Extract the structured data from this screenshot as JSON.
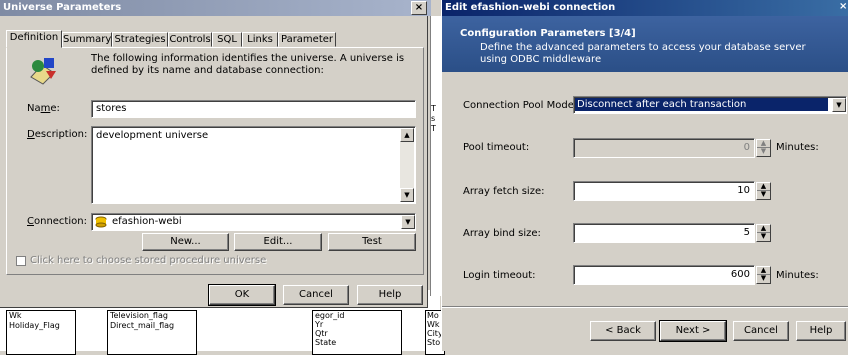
{
  "left": {
    "title": "Universe Parameters",
    "tabs": [
      "Definition",
      "Summary",
      "Strategies",
      "Controls",
      "SQL",
      "Links",
      "Parameter"
    ],
    "intro": "The following information identifies the universe. A universe is defined by its name and database connection:",
    "name_label": "Name:",
    "name_value": "stores",
    "description_label": "Description:",
    "description_value": "development universe",
    "connection_label": "Connection:",
    "connection_value": "efashion-webi",
    "new_button": "New...",
    "edit_button": "Edit...",
    "test_button": "Test",
    "stored_proc_label": "Click here to choose stored procedure universe",
    "ok_button": "OK",
    "cancel_button": "Cancel",
    "help_button": "Help"
  },
  "background": {
    "col1": [
      "Wk",
      "Holiday_Flag"
    ],
    "col2": [
      "Television_flag",
      "Direct_mail_flag"
    ],
    "col3": [
      "Yr",
      "Qtr",
      "State"
    ],
    "col4": [
      "Mo",
      "Wk",
      "City",
      "Sto"
    ],
    "col3_partial": "egor_id",
    "col5_partial": [
      "T",
      "s",
      "T"
    ]
  },
  "right": {
    "title": "Edit efashion-webi connection",
    "header_title": "Configuration Parameters [3/4]",
    "header_desc": "Define the advanced parameters to access your database server using ODBC middleware",
    "pool_mode_label": "Connection Pool Mode",
    "pool_mode_value": "Disconnect after each transaction",
    "pool_timeout_label": "Pool timeout:",
    "pool_timeout_value": "0",
    "pool_timeout_unit": "Minutes:",
    "array_fetch_label": "Array fetch size:",
    "array_fetch_value": "10",
    "array_bind_label": "Array bind size:",
    "array_bind_value": "5",
    "login_timeout_label": "Login timeout:",
    "login_timeout_value": "600",
    "login_timeout_unit": "Minutes:",
    "back_button": "< Back",
    "next_button": "Next >",
    "cancel_button": "Cancel",
    "help_button": "Help"
  },
  "colors": {
    "active_title": "#0a246a",
    "inactive_title": "#7f8ba4",
    "header_bg": "#3a5a8c"
  }
}
